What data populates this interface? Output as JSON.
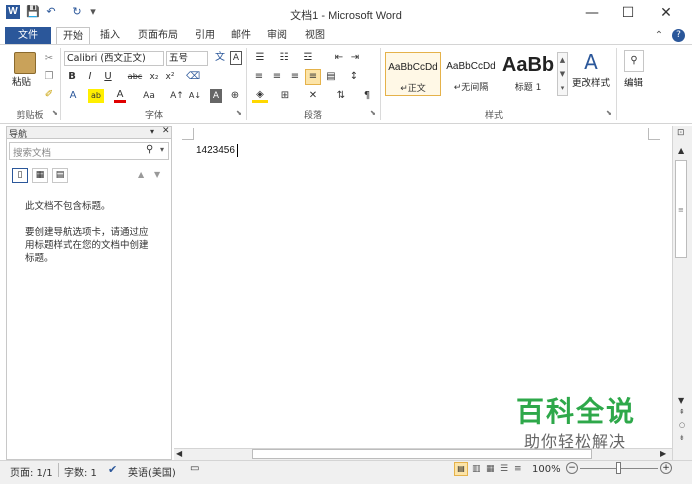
{
  "titlebar": {
    "logo": "W",
    "title": "文档1 - Microsoft Word",
    "qat": [
      "💾",
      "↶",
      "↻",
      "▾"
    ],
    "minimize": "—",
    "maximize": "☐",
    "close": "✕"
  },
  "tabs": [
    "文件",
    "开始",
    "插入",
    "页面布局",
    "引用",
    "邮件",
    "审阅",
    "视图"
  ],
  "tabbar_right": [
    "⌃",
    "?"
  ],
  "ribbon": {
    "clipboard": {
      "paste": "粘贴",
      "label": "剪贴板"
    },
    "font": {
      "name": "Calibri (西文正文)",
      "size": "五号",
      "label": "字体",
      "row2": [
        "B",
        "I",
        "U",
        "abc",
        "x₂",
        "x²"
      ],
      "row3": [
        "A",
        "ab",
        "A",
        "Aa",
        "A↑",
        "A↓",
        "A",
        "⊕"
      ]
    },
    "paragraph": {
      "label": "段落"
    },
    "styles": {
      "label": "样式",
      "items": [
        {
          "sample": "AaBbCcDd",
          "name": "↵正文"
        },
        {
          "sample": "AaBbCcDd",
          "name": "↵无间隔"
        },
        {
          "sample": "AaBb",
          "name": "标题 1"
        }
      ],
      "change": "更改样式"
    },
    "editing": {
      "label": "编辑"
    }
  },
  "nav": {
    "title": "导航",
    "search_placeholder": "搜索文档",
    "message1": "此文档不包含标题。",
    "message2": "要创建导航选项卡，请通过应用标题样式在您的文档中创建标题。"
  },
  "document": {
    "text": "1423456"
  },
  "status": {
    "page": "页面: 1/1",
    "words": "字数: 1",
    "language": "英语(美国)",
    "zoom": "100%"
  },
  "watermark": {
    "line1": "百科全说",
    "line2": "助你轻松解决"
  }
}
